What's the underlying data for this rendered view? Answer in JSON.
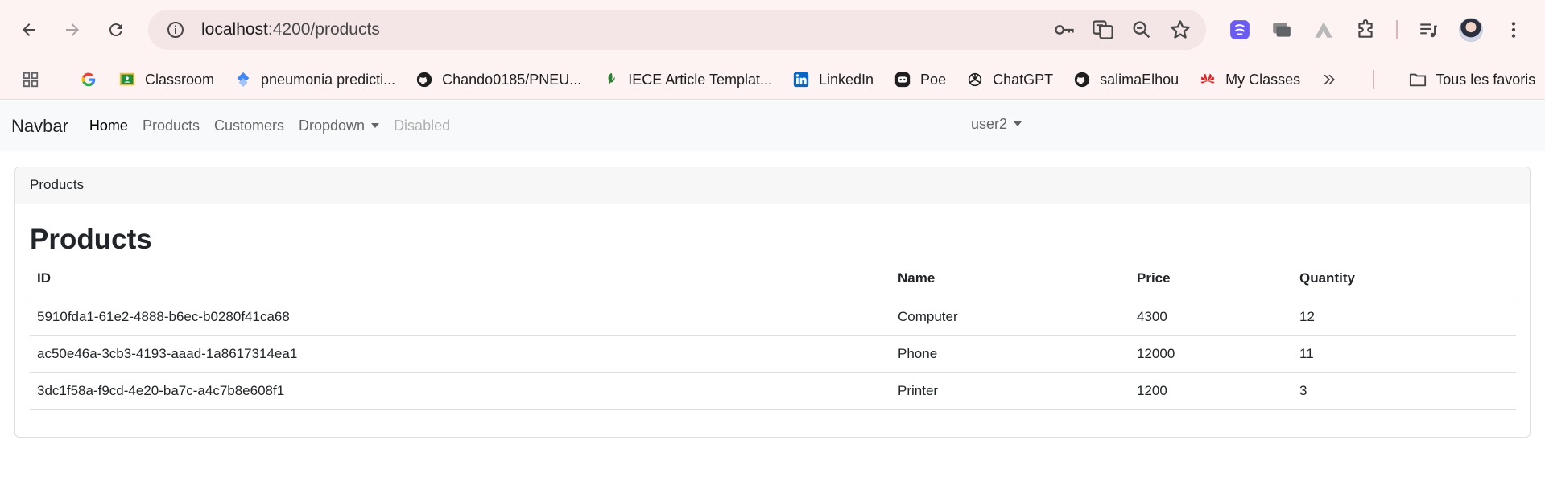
{
  "browser": {
    "url_host": "localhost",
    "url_path": ":4200/products",
    "bookmarks": [
      {
        "label": "",
        "icon": "google-icon"
      },
      {
        "label": "Classroom",
        "icon": "classroom-icon"
      },
      {
        "label": "pneumonia predicti...",
        "icon": "diamond-icon"
      },
      {
        "label": "Chando0185/PNEU...",
        "icon": "github-icon"
      },
      {
        "label": "IECE Article Templat...",
        "icon": "leaf-icon"
      },
      {
        "label": "LinkedIn",
        "icon": "linkedin-icon"
      },
      {
        "label": "Poe",
        "icon": "poe-icon"
      },
      {
        "label": "ChatGPT",
        "icon": "chatgpt-icon"
      },
      {
        "label": "salimaElhou",
        "icon": "github-icon"
      },
      {
        "label": "My Classes",
        "icon": "huawei-icon"
      }
    ],
    "all_bookmarks_label": "Tous les favoris"
  },
  "navbar": {
    "brand": "Navbar",
    "links": [
      "Home",
      "Products",
      "Customers",
      "Dropdown",
      "Disabled"
    ],
    "user": "user2"
  },
  "card": {
    "header": "Products",
    "title": "Products",
    "columns": [
      "ID",
      "Name",
      "Price",
      "Quantity"
    ],
    "rows": [
      [
        "5910fda1-61e2-4888-b6ec-b0280f41ca68",
        "Computer",
        "4300",
        "12"
      ],
      [
        "ac50e46a-3cb3-4193-aaad-1a8617314ea1",
        "Phone",
        "12000",
        "11"
      ],
      [
        "3dc1f58a-f9cd-4e20-ba7c-a4c7b8e608f1",
        "Printer",
        "1200",
        "3"
      ]
    ]
  },
  "colors": {
    "chrome_bg": "#fdf3f3",
    "omnibox_bg": "#f4e5e6",
    "navbar_bg": "#f8f9fa"
  }
}
